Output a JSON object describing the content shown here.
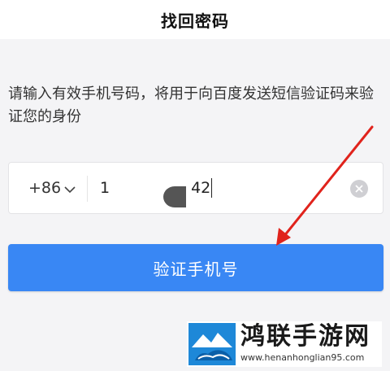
{
  "header": {
    "title": "找回密码"
  },
  "description": "请输入有效手机号码，将用于向百度发送短信验证码来验证您的身份",
  "phone": {
    "country_code": "+86",
    "number_prefix": "1",
    "number_suffix": "42"
  },
  "verify_button": {
    "label": "验证手机号"
  },
  "watermark": {
    "name": "鸿联手游网",
    "url": "www.henanhonglian95.com"
  },
  "colors": {
    "primary": "#3987f4",
    "arrow": "#e0231c",
    "background": "#f4f4f6"
  }
}
